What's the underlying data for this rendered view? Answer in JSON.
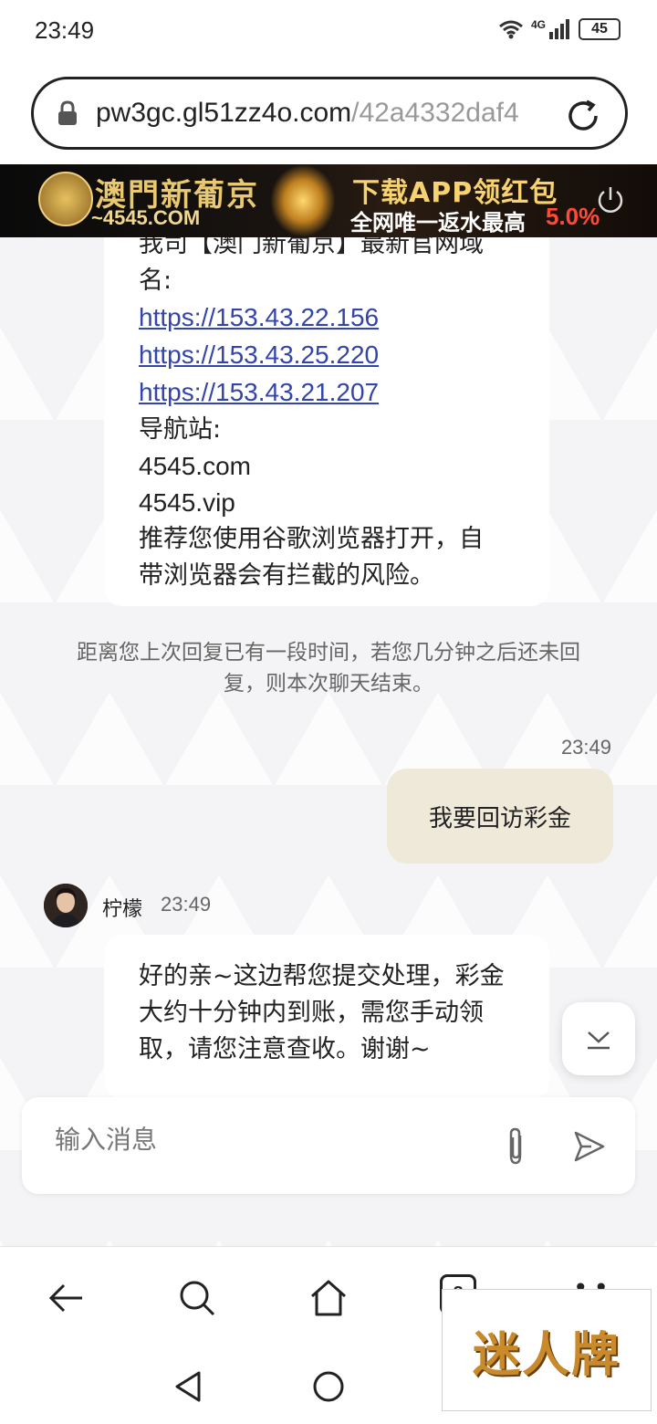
{
  "status_bar": {
    "time": "23:49",
    "network": "4G",
    "battery": "45"
  },
  "browser": {
    "url_host": "pw3gc.gl51zz4o.com",
    "url_path": "/42a4332daf4"
  },
  "ad_banner": {
    "brand": "澳門新葡京",
    "domain": "~4545.COM",
    "headline": "下载APP领红包",
    "subline": "全网唯一返水最高",
    "rate": "5.0%"
  },
  "chat": {
    "top_message": {
      "partial_line": "我司【澳门新葡京】最新官网域",
      "line_2": "名:",
      "links": [
        "https://153.43.22.156",
        "https://153.43.25.220",
        "https://153.43.21.207"
      ],
      "nav_label": "导航站:",
      "nav_sites": [
        "4545.com",
        "4545.vip"
      ],
      "advice_line_1": "推荐您使用谷歌浏览器打开，自",
      "advice_line_2": "带浏览器会有拦截的风险。"
    },
    "system_notice_line_1": "距离您上次回复已有一段时间，若您几分钟之后还未回",
    "system_notice_line_2": "复，则本次聊天结束。",
    "user_message": {
      "time": "23:49",
      "text": "我要回访彩金"
    },
    "agent_message": {
      "name": "柠檬",
      "time": "23:49",
      "line_1": "好的亲~这边帮您提交处理，彩金",
      "line_2": "大约十分钟内到账，需您手动领",
      "line_3": "取，请您注意查收。谢谢~"
    },
    "input": {
      "placeholder": "输入消息",
      "value": ""
    }
  },
  "browser_nav": {
    "tabs_count": "8"
  },
  "watermark": {
    "text": "迷人牌"
  },
  "colors": {
    "link": "#3344aa",
    "user_bubble": "#efe9d9",
    "chat_bg": "#f4f4f6",
    "ad_gold": "#f6d270",
    "ad_red": "#ff4a3a"
  },
  "icons": [
    "lock-icon",
    "reload-icon",
    "power-icon",
    "chevron-down-icon",
    "paperclip-icon",
    "send-icon",
    "back-arrow-icon",
    "search-icon",
    "home-icon",
    "more-icon"
  ]
}
